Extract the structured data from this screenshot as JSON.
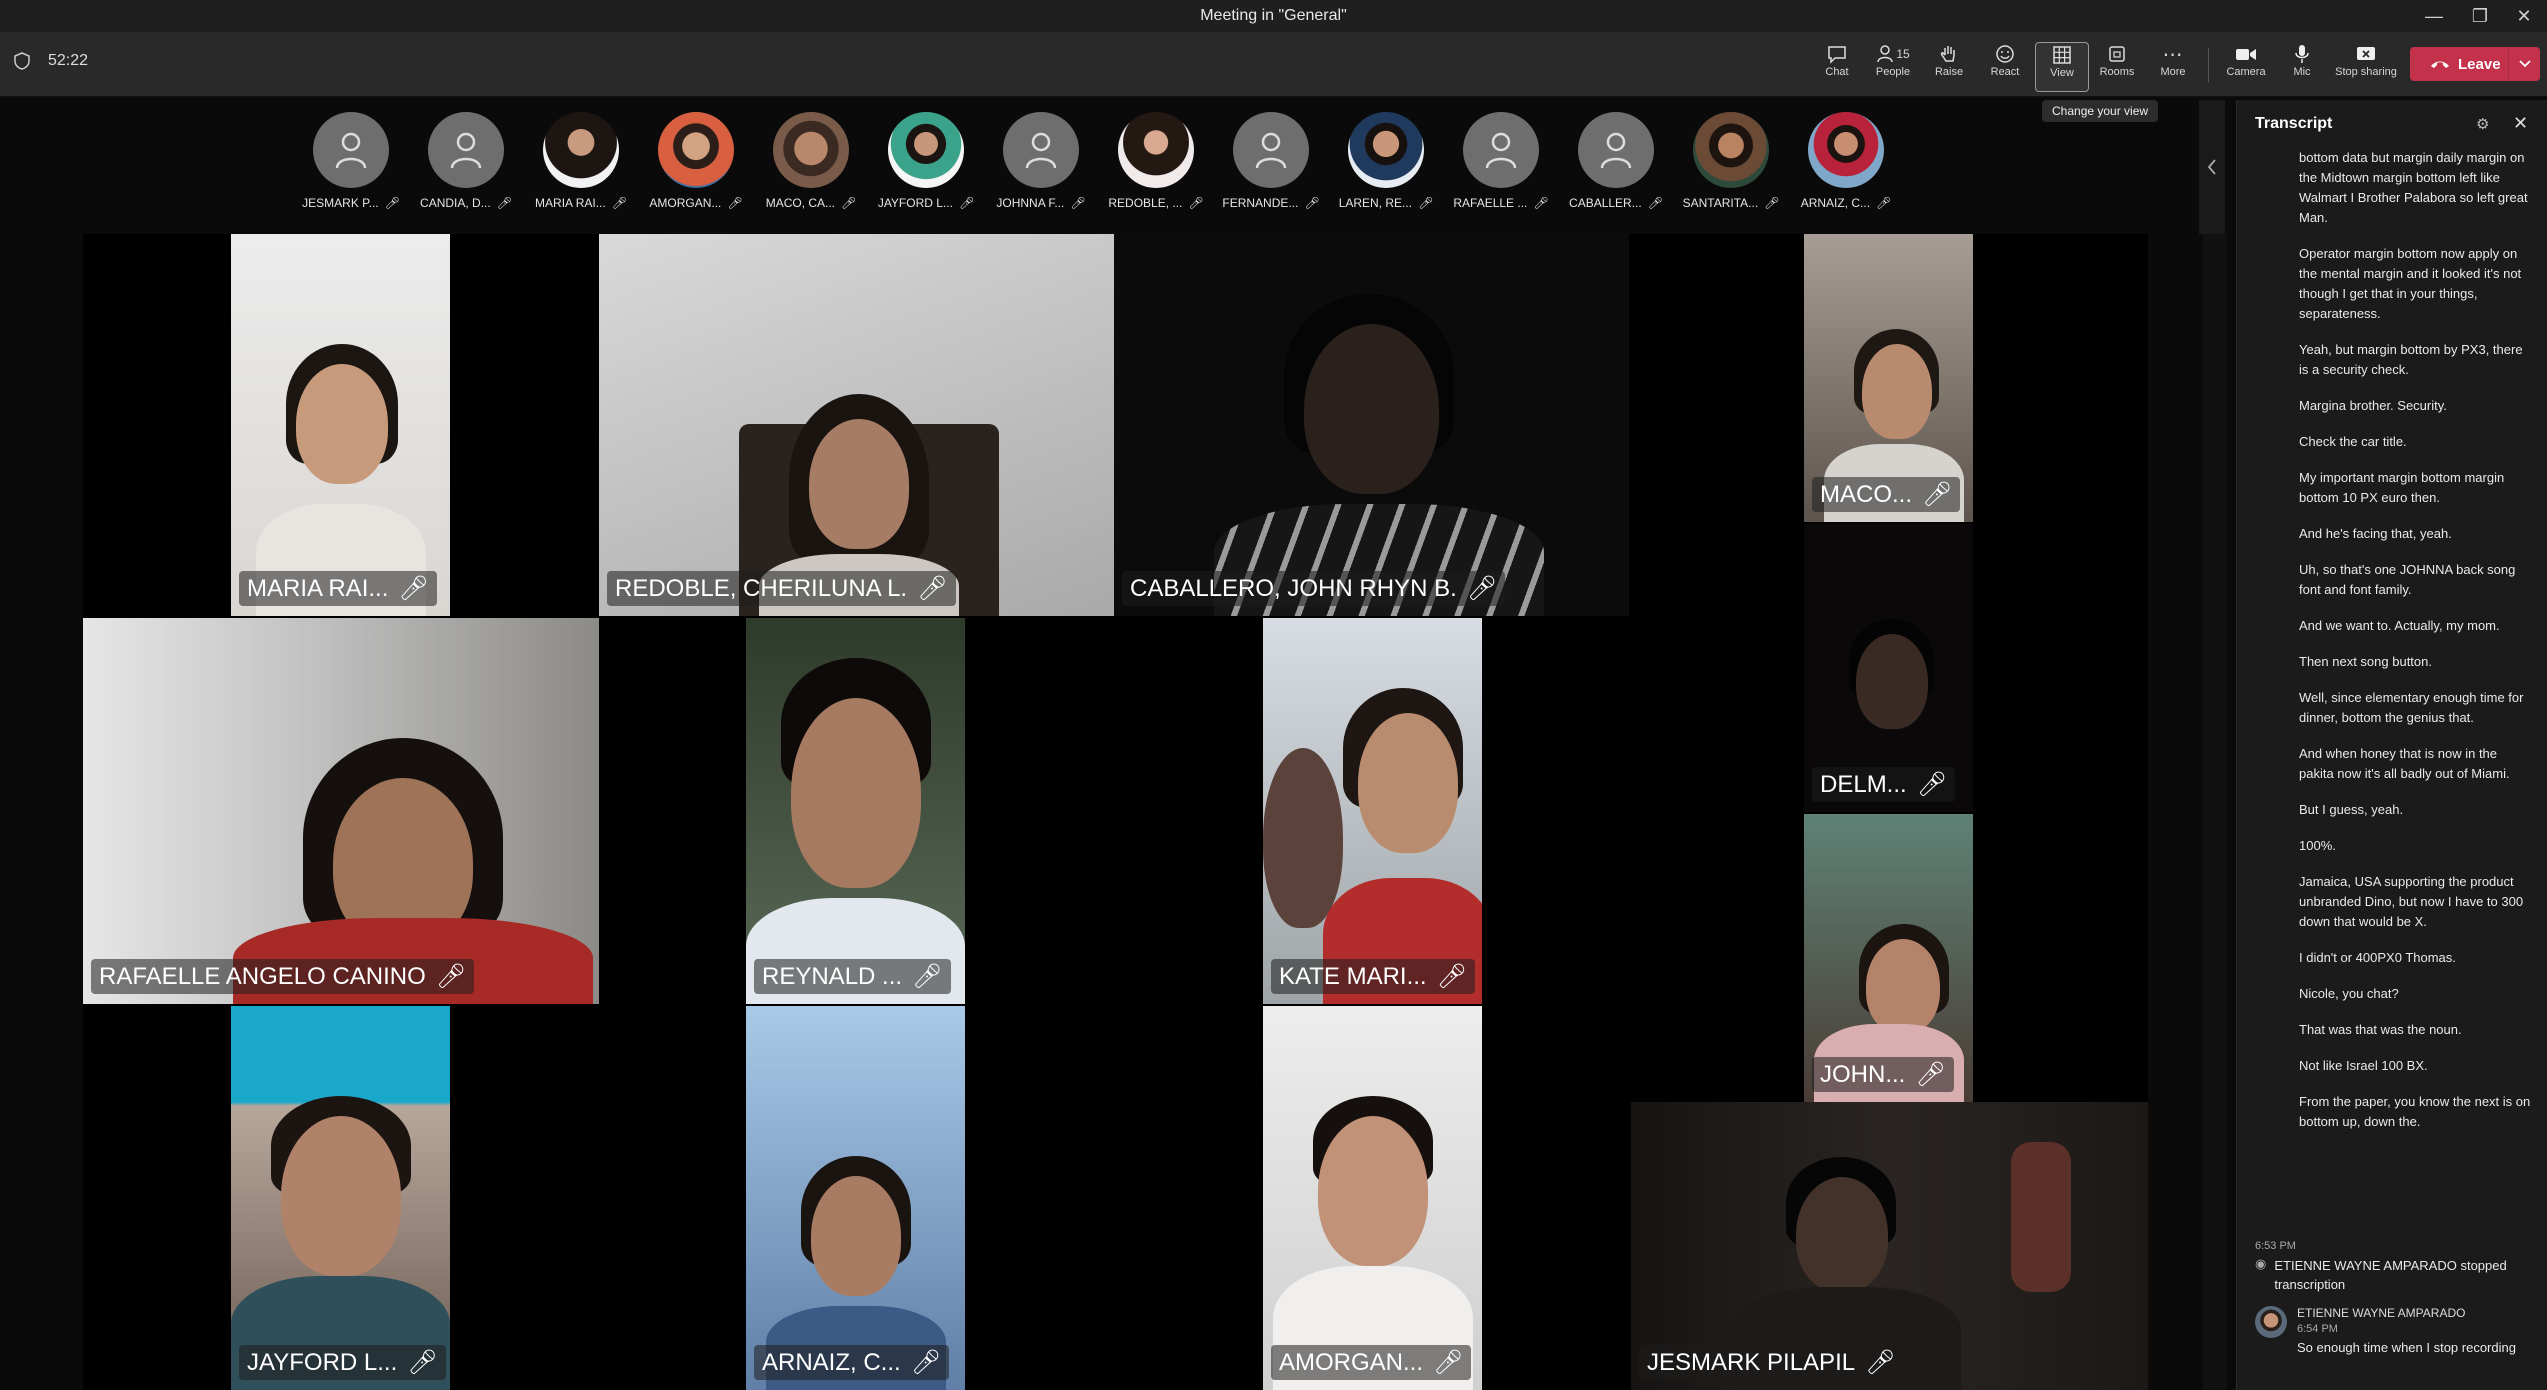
{
  "window": {
    "title": "Meeting in \"General\""
  },
  "toolbar": {
    "timer": "52:22",
    "buttons": [
      {
        "key": "chat",
        "label": "Chat"
      },
      {
        "key": "people",
        "label": "People",
        "count": "15"
      },
      {
        "key": "raise",
        "label": "Raise"
      },
      {
        "key": "react",
        "label": "React"
      },
      {
        "key": "view",
        "label": "View"
      },
      {
        "key": "rooms",
        "label": "Rooms"
      },
      {
        "key": "more",
        "label": "More"
      },
      {
        "key": "camera",
        "label": "Camera"
      },
      {
        "key": "mic",
        "label": "Mic"
      },
      {
        "key": "stop",
        "label": "Stop sharing"
      }
    ],
    "leave_label": "Leave",
    "tooltip": "Change your view"
  },
  "attendees": [
    {
      "name": "JESMARK P...",
      "photo": false
    },
    {
      "name": "CANDIA, D...",
      "photo": false
    },
    {
      "name": "MARIA RAI...",
      "photo": true
    },
    {
      "name": "AMORGAN...",
      "photo": true
    },
    {
      "name": "MACO, CA...",
      "photo": true
    },
    {
      "name": "JAYFORD L...",
      "photo": true
    },
    {
      "name": "JOHNNA F...",
      "photo": false
    },
    {
      "name": "REDOBLE, ...",
      "photo": true
    },
    {
      "name": "FERNANDE...",
      "photo": false
    },
    {
      "name": "LAREN, RE...",
      "photo": true
    },
    {
      "name": "RAFAELLE ...",
      "photo": false
    },
    {
      "name": "CABALLER...",
      "photo": false
    },
    {
      "name": "SANTARITA...",
      "photo": true
    },
    {
      "name": "ARNAIZ, C...",
      "photo": true
    }
  ],
  "tiles": [
    {
      "name": "MARIA RAI..."
    },
    {
      "name": "REDOBLE, CHERILUNA L."
    },
    {
      "name": "CABALLERO, JOHN RHYN B."
    },
    {
      "name": "MACO..."
    },
    {
      "name": "RAFAELLE ANGELO CANINO"
    },
    {
      "name": "REYNALD ..."
    },
    {
      "name": "KATE MARI..."
    },
    {
      "name": "DELM..."
    },
    {
      "name": "JOHN..."
    },
    {
      "name": "JAYFORD L..."
    },
    {
      "name": "ARNAIZ, C..."
    },
    {
      "name": "AMORGAN..."
    },
    {
      "name": "JESMARK PILAPIL"
    }
  ],
  "transcript": {
    "title": "Transcript",
    "entries": [
      "bottom data but margin daily margin on the Midtown margin bottom left like Walmart I Brother Palabora so left great Man.",
      "Operator margin bottom now apply on the mental margin and it looked it's not though I get that in your things, separateness.",
      "Yeah, but margin bottom by PX3, there is a security check.",
      "Margina brother. Security.",
      "Check the car title.",
      "My important margin bottom margin bottom 10 PX euro then.",
      "And he's facing that, yeah.",
      "Uh, so that's one JOHNNA back song font and font family.",
      "And we want to. Actually, my mom.",
      "Then next song button.",
      "Well, since elementary enough time for dinner, bottom the genius that.",
      "And when honey that is now in the pakita now it's all badly out of Miami.",
      "But I guess, yeah.",
      "100%.",
      "Jamaica, USA supporting the product unbranded Dino, but now I have to 300 down that would be X.",
      "I didn't or 400PX0 Thomas.",
      "Nicole, you chat?",
      "That was that was the noun.",
      "Not like Israel 100 BX.",
      "From the paper, you know the next is on bottom up, down the."
    ],
    "event_time": "6:53 PM",
    "event_text": "ETIENNE WAYNE AMPARADO stopped transcription",
    "last_speaker": "ETIENNE WAYNE AMPARADO",
    "last_time": "6:54 PM",
    "last_text": "So enough time when I stop recording"
  },
  "colors": {
    "leave": "#c4314b",
    "accent": "#6264a7"
  }
}
